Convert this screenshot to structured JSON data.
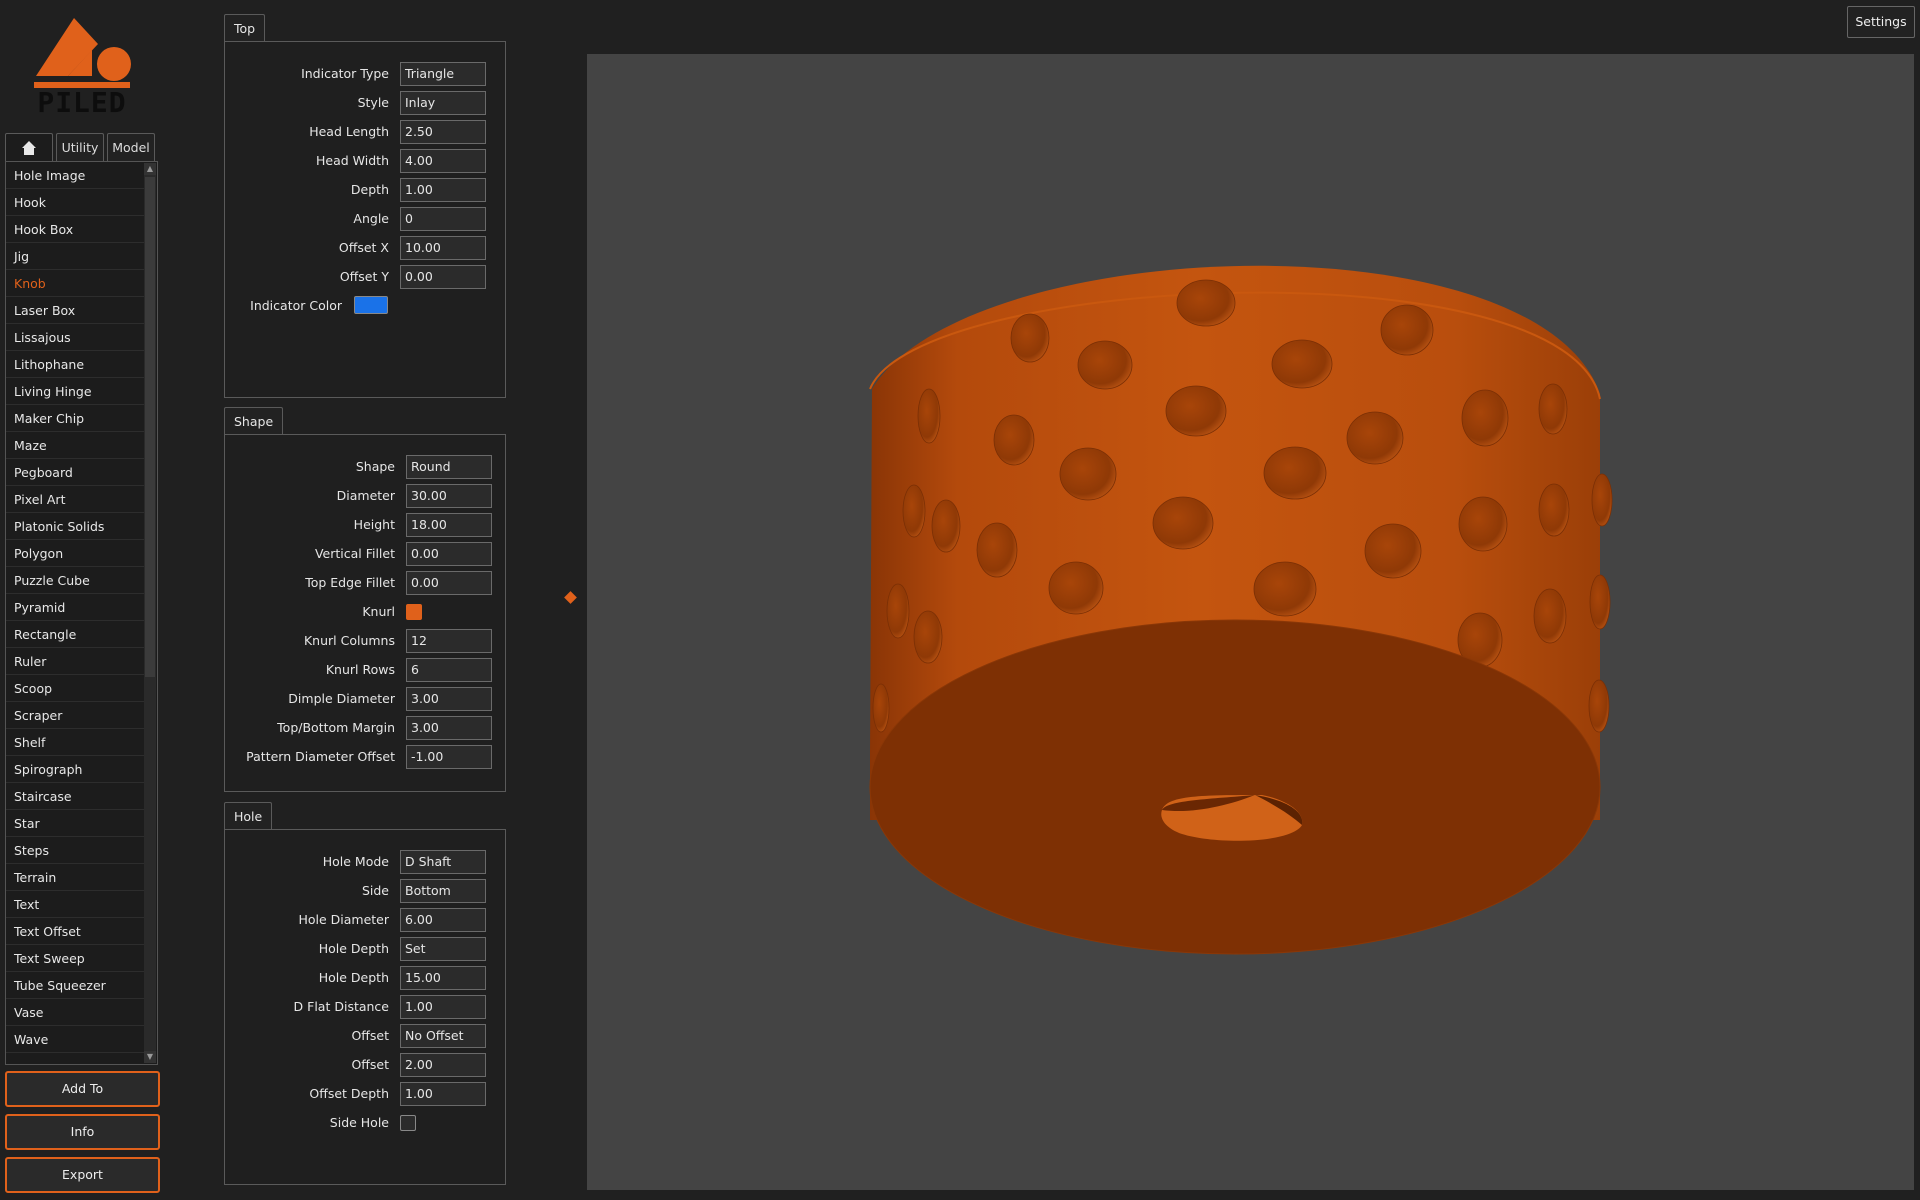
{
  "logo": {
    "text": "PILED",
    "color": "#e0611b"
  },
  "left_tabs": [
    {
      "label": "",
      "icon": "home-icon"
    },
    {
      "label": "Utility"
    },
    {
      "label": "Model"
    }
  ],
  "model_list": {
    "items": [
      "Hole Image",
      "Hook",
      "Hook Box",
      "Jig",
      "Knob",
      "Laser Box",
      "Lissajous",
      "Lithophane",
      "Living Hinge",
      "Maker Chip",
      "Maze",
      "Pegboard",
      "Pixel Art",
      "Platonic Solids",
      "Polygon",
      "Puzzle Cube",
      "Pyramid",
      "Rectangle",
      "Ruler",
      "Scoop",
      "Scraper",
      "Shelf",
      "Spirograph",
      "Staircase",
      "Star",
      "Steps",
      "Terrain",
      "Text",
      "Text Offset",
      "Text Sweep",
      "Tube Squeezer",
      "Vase",
      "Wave"
    ],
    "selected": "Knob"
  },
  "buttons": {
    "add_to": "Add To",
    "info": "Info",
    "export": "Export"
  },
  "settings_label": "Settings",
  "accent_color": "#e0611b",
  "panels": {
    "top": {
      "title": "Top",
      "fields": [
        {
          "label": "Indicator Type",
          "value": "Triangle"
        },
        {
          "label": "Style",
          "value": "Inlay"
        },
        {
          "label": "Head Length",
          "value": "2.50"
        },
        {
          "label": "Head Width",
          "value": "4.00"
        },
        {
          "label": "Depth",
          "value": "1.00"
        },
        {
          "label": "Angle",
          "value": "0"
        },
        {
          "label": "Offset X",
          "value": "10.00"
        },
        {
          "label": "Offset Y",
          "value": "0.00"
        }
      ],
      "indicator_color_label": "Indicator Color",
      "indicator_color": "#1a72e8"
    },
    "shape": {
      "title": "Shape",
      "fields_a": [
        {
          "label": "Shape",
          "value": "Round"
        },
        {
          "label": "Diameter",
          "value": "30.00"
        },
        {
          "label": "Height",
          "value": "18.00"
        },
        {
          "label": "Vertical Fillet",
          "value": "0.00"
        },
        {
          "label": "Top Edge Fillet",
          "value": "0.00"
        }
      ],
      "knurl_label": "Knurl",
      "knurl_checked": true,
      "fields_b": [
        {
          "label": "Knurl Columns",
          "value": "12"
        },
        {
          "label": "Knurl Rows",
          "value": "6"
        },
        {
          "label": "Dimple Diameter",
          "value": "3.00"
        },
        {
          "label": "Top/Bottom Margin",
          "value": "3.00"
        },
        {
          "label": "Pattern Diameter Offset",
          "value": "-1.00"
        }
      ]
    },
    "hole": {
      "title": "Hole",
      "fields": [
        {
          "label": "Hole Mode",
          "value": "D Shaft"
        },
        {
          "label": "Side",
          "value": "Bottom"
        },
        {
          "label": "Hole Diameter",
          "value": "6.00"
        },
        {
          "label": "Hole Depth",
          "value": "Set"
        },
        {
          "label": "Hole Depth",
          "value": "15.00"
        },
        {
          "label": "D Flat Distance",
          "value": "1.00"
        },
        {
          "label": "Offset",
          "value": "No Offset"
        },
        {
          "label": "Offset",
          "value": "2.00"
        },
        {
          "label": "Offset Depth",
          "value": "1.00"
        }
      ],
      "side_hole_label": "Side Hole",
      "side_hole_checked": false
    }
  },
  "viewport": {
    "background": "#444444",
    "model_color": "#c0520f"
  }
}
